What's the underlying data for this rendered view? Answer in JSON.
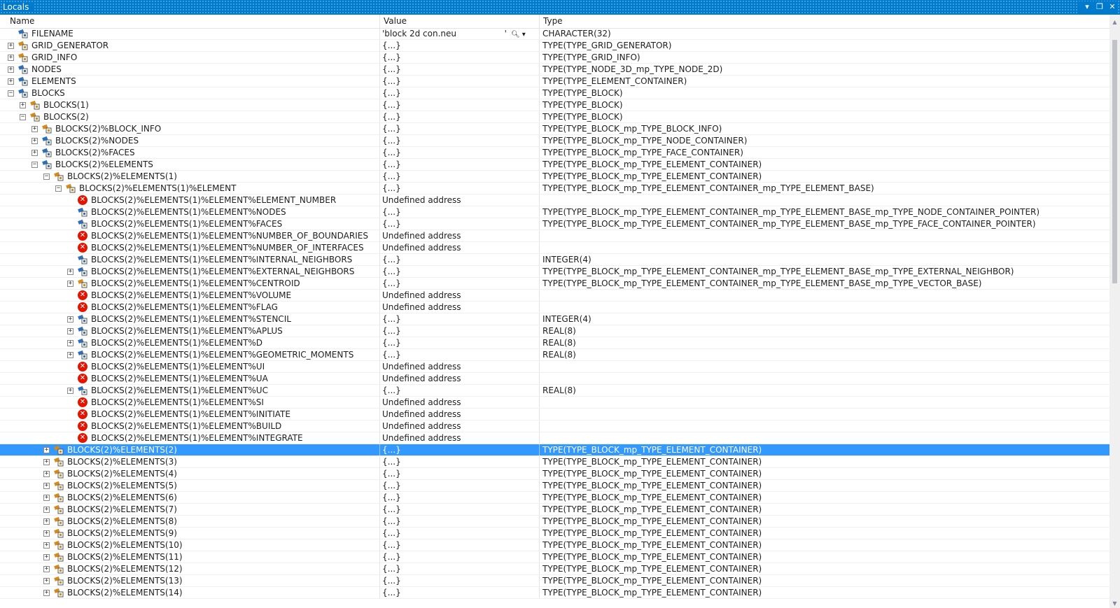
{
  "window": {
    "title": "Locals",
    "controls": [
      "▾",
      "❐",
      "✕"
    ]
  },
  "columns": {
    "name": "Name",
    "value": "Value",
    "type": "Type"
  },
  "colors": {
    "selection": "#3399ff",
    "titlebar": "#007acc",
    "error": "#e51400",
    "icon_blue": "#2c6fbf",
    "icon_orange": "#d68a1b"
  },
  "rows": [
    {
      "name": "FILENAME",
      "value": "'block 2d con.neu                  '",
      "type": "CHARACTER(32)",
      "depth": 0,
      "exp": "",
      "icon": "struct-blue",
      "magnifier": true
    },
    {
      "name": "GRID_GENERATOR",
      "value": "{...}",
      "type": "TYPE(TYPE_GRID_GENERATOR)",
      "depth": 0,
      "exp": "+",
      "icon": "struct-orange"
    },
    {
      "name": "GRID_INFO",
      "value": "{...}",
      "type": "TYPE(TYPE_GRID_INFO)",
      "depth": 0,
      "exp": "+",
      "icon": "struct-orange"
    },
    {
      "name": "NODES",
      "value": "{...}",
      "type": "TYPE(TYPE_NODE_3D_mp_TYPE_NODE_2D)",
      "depth": 0,
      "exp": "+",
      "icon": "struct-blue"
    },
    {
      "name": "ELEMENTS",
      "value": "{...}",
      "type": "TYPE(TYPE_ELEMENT_CONTAINER)",
      "depth": 0,
      "exp": "+",
      "icon": "struct-blue"
    },
    {
      "name": "BLOCKS",
      "value": "{...}",
      "type": "TYPE(TYPE_BLOCK)",
      "depth": 0,
      "exp": "-",
      "icon": "struct-blue"
    },
    {
      "name": "BLOCKS(1)",
      "value": "{...}",
      "type": "TYPE(TYPE_BLOCK)",
      "depth": 1,
      "exp": "+",
      "icon": "struct-orange"
    },
    {
      "name": "BLOCKS(2)",
      "value": "{...}",
      "type": "TYPE(TYPE_BLOCK)",
      "depth": 1,
      "exp": "-",
      "icon": "struct-orange"
    },
    {
      "name": "BLOCKS(2)%BLOCK_INFO",
      "value": "{...}",
      "type": "TYPE(TYPE_BLOCK_mp_TYPE_BLOCK_INFO)",
      "depth": 2,
      "exp": "+",
      "icon": "struct-orange"
    },
    {
      "name": "BLOCKS(2)%NODES",
      "value": "{...}",
      "type": "TYPE(TYPE_BLOCK_mp_TYPE_NODE_CONTAINER)",
      "depth": 2,
      "exp": "+",
      "icon": "struct-blue"
    },
    {
      "name": "BLOCKS(2)%FACES",
      "value": "{...}",
      "type": "TYPE(TYPE_BLOCK_mp_TYPE_FACE_CONTAINER)",
      "depth": 2,
      "exp": "+",
      "icon": "struct-blue"
    },
    {
      "name": "BLOCKS(2)%ELEMENTS",
      "value": "{...}",
      "type": "TYPE(TYPE_BLOCK_mp_TYPE_ELEMENT_CONTAINER)",
      "depth": 2,
      "exp": "-",
      "icon": "struct-blue"
    },
    {
      "name": "BLOCKS(2)%ELEMENTS(1)",
      "value": "{...}",
      "type": "TYPE(TYPE_BLOCK_mp_TYPE_ELEMENT_CONTAINER)",
      "depth": 3,
      "exp": "-",
      "icon": "struct-orange"
    },
    {
      "name": "BLOCKS(2)%ELEMENTS(1)%ELEMENT",
      "value": "{...}",
      "type": "TYPE(TYPE_BLOCK_mp_TYPE_ELEMENT_CONTAINER_mp_TYPE_ELEMENT_BASE)",
      "depth": 4,
      "exp": "-",
      "icon": "struct-orange"
    },
    {
      "name": "BLOCKS(2)%ELEMENTS(1)%ELEMENT%ELEMENT_NUMBER",
      "value": "Undefined address",
      "type": "",
      "depth": 5,
      "exp": "",
      "icon": "error"
    },
    {
      "name": "BLOCKS(2)%ELEMENTS(1)%ELEMENT%NODES",
      "value": "{...}",
      "type": "TYPE(TYPE_BLOCK_mp_TYPE_ELEMENT_CONTAINER_mp_TYPE_ELEMENT_BASE_mp_TYPE_NODE_CONTAINER_POINTER)",
      "depth": 5,
      "exp": "",
      "icon": "struct-blue"
    },
    {
      "name": "BLOCKS(2)%ELEMENTS(1)%ELEMENT%FACES",
      "value": "{...}",
      "type": "TYPE(TYPE_BLOCK_mp_TYPE_ELEMENT_CONTAINER_mp_TYPE_ELEMENT_BASE_mp_TYPE_FACE_CONTAINER_POINTER)",
      "depth": 5,
      "exp": "",
      "icon": "struct-blue"
    },
    {
      "name": "BLOCKS(2)%ELEMENTS(1)%ELEMENT%NUMBER_OF_BOUNDARIES",
      "value": "Undefined address",
      "type": "",
      "depth": 5,
      "exp": "",
      "icon": "error"
    },
    {
      "name": "BLOCKS(2)%ELEMENTS(1)%ELEMENT%NUMBER_OF_INTERFACES",
      "value": "Undefined address",
      "type": "",
      "depth": 5,
      "exp": "",
      "icon": "error"
    },
    {
      "name": "BLOCKS(2)%ELEMENTS(1)%ELEMENT%INTERNAL_NEIGHBORS",
      "value": "{...}",
      "type": "INTEGER(4)",
      "depth": 5,
      "exp": "",
      "icon": "struct-blue"
    },
    {
      "name": "BLOCKS(2)%ELEMENTS(1)%ELEMENT%EXTERNAL_NEIGHBORS",
      "value": "{...}",
      "type": "TYPE(TYPE_BLOCK_mp_TYPE_ELEMENT_CONTAINER_mp_TYPE_ELEMENT_BASE_mp_TYPE_EXTERNAL_NEIGHBOR)",
      "depth": 5,
      "exp": "+",
      "icon": "struct-blue"
    },
    {
      "name": "BLOCKS(2)%ELEMENTS(1)%ELEMENT%CENTROID",
      "value": "{...}",
      "type": "TYPE(TYPE_BLOCK_mp_TYPE_ELEMENT_CONTAINER_mp_TYPE_ELEMENT_BASE_mp_TYPE_VECTOR_BASE)",
      "depth": 5,
      "exp": "+",
      "icon": "struct-orange"
    },
    {
      "name": "BLOCKS(2)%ELEMENTS(1)%ELEMENT%VOLUME",
      "value": "Undefined address",
      "type": "",
      "depth": 5,
      "exp": "",
      "icon": "error"
    },
    {
      "name": "BLOCKS(2)%ELEMENTS(1)%ELEMENT%FLAG",
      "value": "Undefined address",
      "type": "",
      "depth": 5,
      "exp": "",
      "icon": "error"
    },
    {
      "name": "BLOCKS(2)%ELEMENTS(1)%ELEMENT%STENCIL",
      "value": "{...}",
      "type": "INTEGER(4)",
      "depth": 5,
      "exp": "+",
      "icon": "struct-blue"
    },
    {
      "name": "BLOCKS(2)%ELEMENTS(1)%ELEMENT%APLUS",
      "value": "{...}",
      "type": "REAL(8)",
      "depth": 5,
      "exp": "+",
      "icon": "struct-blue"
    },
    {
      "name": "BLOCKS(2)%ELEMENTS(1)%ELEMENT%D",
      "value": "{...}",
      "type": "REAL(8)",
      "depth": 5,
      "exp": "+",
      "icon": "struct-blue"
    },
    {
      "name": "BLOCKS(2)%ELEMENTS(1)%ELEMENT%GEOMETRIC_MOMENTS",
      "value": "{...}",
      "type": "REAL(8)",
      "depth": 5,
      "exp": "+",
      "icon": "struct-blue"
    },
    {
      "name": "BLOCKS(2)%ELEMENTS(1)%ELEMENT%UI",
      "value": "Undefined address",
      "type": "",
      "depth": 5,
      "exp": "",
      "icon": "error"
    },
    {
      "name": "BLOCKS(2)%ELEMENTS(1)%ELEMENT%UA",
      "value": "Undefined address",
      "type": "",
      "depth": 5,
      "exp": "",
      "icon": "error"
    },
    {
      "name": "BLOCKS(2)%ELEMENTS(1)%ELEMENT%UC",
      "value": "{...}",
      "type": "REAL(8)",
      "depth": 5,
      "exp": "+",
      "icon": "struct-blue"
    },
    {
      "name": "BLOCKS(2)%ELEMENTS(1)%ELEMENT%SI",
      "value": "Undefined address",
      "type": "",
      "depth": 5,
      "exp": "",
      "icon": "error"
    },
    {
      "name": "BLOCKS(2)%ELEMENTS(1)%ELEMENT%INITIATE",
      "value": "Undefined address",
      "type": "",
      "depth": 5,
      "exp": "",
      "icon": "error"
    },
    {
      "name": "BLOCKS(2)%ELEMENTS(1)%ELEMENT%BUILD",
      "value": "Undefined address",
      "type": "",
      "depth": 5,
      "exp": "",
      "icon": "error"
    },
    {
      "name": "BLOCKS(2)%ELEMENTS(1)%ELEMENT%INTEGRATE",
      "value": "Undefined address",
      "type": "",
      "depth": 5,
      "exp": "",
      "icon": "error"
    },
    {
      "name": "BLOCKS(2)%ELEMENTS(2)",
      "value": "{...}",
      "type": "TYPE(TYPE_BLOCK_mp_TYPE_ELEMENT_CONTAINER)",
      "depth": 3,
      "exp": "+",
      "icon": "struct-orange",
      "selected": true
    },
    {
      "name": "BLOCKS(2)%ELEMENTS(3)",
      "value": "{...}",
      "type": "TYPE(TYPE_BLOCK_mp_TYPE_ELEMENT_CONTAINER)",
      "depth": 3,
      "exp": "+",
      "icon": "struct-orange"
    },
    {
      "name": "BLOCKS(2)%ELEMENTS(4)",
      "value": "{...}",
      "type": "TYPE(TYPE_BLOCK_mp_TYPE_ELEMENT_CONTAINER)",
      "depth": 3,
      "exp": "+",
      "icon": "struct-orange"
    },
    {
      "name": "BLOCKS(2)%ELEMENTS(5)",
      "value": "{...}",
      "type": "TYPE(TYPE_BLOCK_mp_TYPE_ELEMENT_CONTAINER)",
      "depth": 3,
      "exp": "+",
      "icon": "struct-orange"
    },
    {
      "name": "BLOCKS(2)%ELEMENTS(6)",
      "value": "{...}",
      "type": "TYPE(TYPE_BLOCK_mp_TYPE_ELEMENT_CONTAINER)",
      "depth": 3,
      "exp": "+",
      "icon": "struct-orange"
    },
    {
      "name": "BLOCKS(2)%ELEMENTS(7)",
      "value": "{...}",
      "type": "TYPE(TYPE_BLOCK_mp_TYPE_ELEMENT_CONTAINER)",
      "depth": 3,
      "exp": "+",
      "icon": "struct-orange"
    },
    {
      "name": "BLOCKS(2)%ELEMENTS(8)",
      "value": "{...}",
      "type": "TYPE(TYPE_BLOCK_mp_TYPE_ELEMENT_CONTAINER)",
      "depth": 3,
      "exp": "+",
      "icon": "struct-orange"
    },
    {
      "name": "BLOCKS(2)%ELEMENTS(9)",
      "value": "{...}",
      "type": "TYPE(TYPE_BLOCK_mp_TYPE_ELEMENT_CONTAINER)",
      "depth": 3,
      "exp": "+",
      "icon": "struct-orange"
    },
    {
      "name": "BLOCKS(2)%ELEMENTS(10)",
      "value": "{...}",
      "type": "TYPE(TYPE_BLOCK_mp_TYPE_ELEMENT_CONTAINER)",
      "depth": 3,
      "exp": "+",
      "icon": "struct-orange"
    },
    {
      "name": "BLOCKS(2)%ELEMENTS(11)",
      "value": "{...}",
      "type": "TYPE(TYPE_BLOCK_mp_TYPE_ELEMENT_CONTAINER)",
      "depth": 3,
      "exp": "+",
      "icon": "struct-orange"
    },
    {
      "name": "BLOCKS(2)%ELEMENTS(12)",
      "value": "{...}",
      "type": "TYPE(TYPE_BLOCK_mp_TYPE_ELEMENT_CONTAINER)",
      "depth": 3,
      "exp": "+",
      "icon": "struct-orange"
    },
    {
      "name": "BLOCKS(2)%ELEMENTS(13)",
      "value": "{...}",
      "type": "TYPE(TYPE_BLOCK_mp_TYPE_ELEMENT_CONTAINER)",
      "depth": 3,
      "exp": "+",
      "icon": "struct-orange"
    },
    {
      "name": "BLOCKS(2)%ELEMENTS(14)",
      "value": "{...}",
      "type": "TYPE(TYPE_BLOCK_mp_TYPE_ELEMENT_CONTAINER)",
      "depth": 3,
      "exp": "+",
      "icon": "struct-orange"
    }
  ]
}
